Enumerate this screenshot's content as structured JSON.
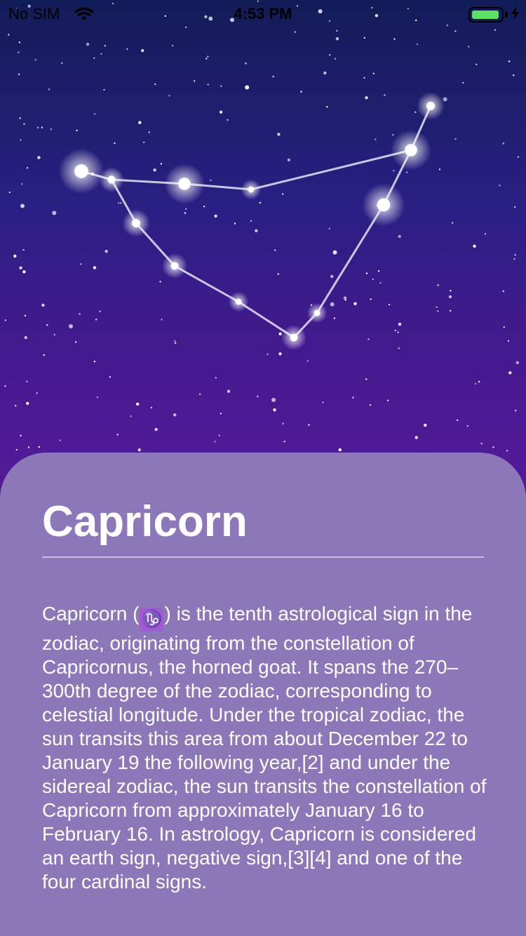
{
  "status_bar": {
    "carrier": "No SIM",
    "time": "4:53 PM",
    "battery_level_pct": 80,
    "battery_color": "#5ee065"
  },
  "constellation": {
    "icon": "capricorn-constellation"
  },
  "detail": {
    "title": "Capricorn",
    "desc_before_glyph": "Capricorn (",
    "sign_glyph": "♑",
    "desc_after_glyph": ") is the tenth astrological sign in the zodiac, originating from the constellation of Capricornus, the horned goat. It spans the 270–300th degree of the zodiac, corresponding to celestial longitude. Under the tropical zodiac, the sun transits this area from about December 22 to January 19 the following year,[2] and under the sidereal zodiac, the sun transits the constellation of Capricorn from approximately January 16 to February 16. In astrology, Capricorn is considered an earth sign, negative sign,[3][4] and one of the four cardinal signs."
  }
}
